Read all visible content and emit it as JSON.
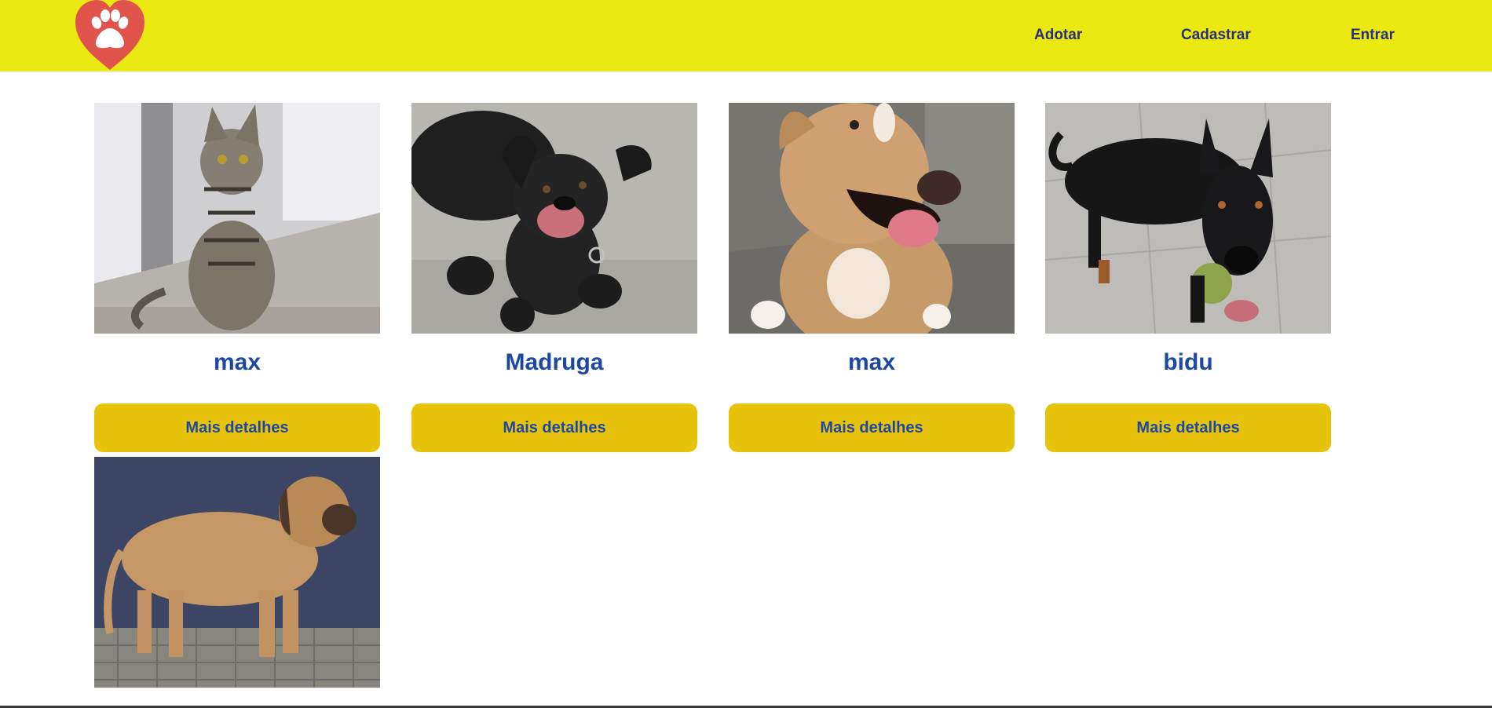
{
  "header": {
    "logo_name": "paw-heart-logo",
    "brand_color": "#eaea12",
    "logo_color": "#e0544c",
    "nav": [
      {
        "label": "Adotar"
      },
      {
        "label": "Cadastrar"
      },
      {
        "label": "Entrar"
      }
    ]
  },
  "pets": [
    {
      "name": "max",
      "photo": "tabby-cat-photo",
      "button_label": "Mais detalhes"
    },
    {
      "name": "Madruga",
      "photo": "black-dog-photo",
      "button_label": "Mais detalhes"
    },
    {
      "name": "max",
      "photo": "tan-pitbull-photo",
      "button_label": "Mais detalhes"
    },
    {
      "name": "bidu",
      "photo": "doberman-with-ball-photo",
      "button_label": "Mais detalhes"
    },
    {
      "name": "",
      "photo": "mastiff-standing-photo",
      "button_label": ""
    }
  ],
  "colors": {
    "name_text": "#1c47a3",
    "button_bg": "#e8c30b",
    "nav_text": "#2b2f7e"
  }
}
